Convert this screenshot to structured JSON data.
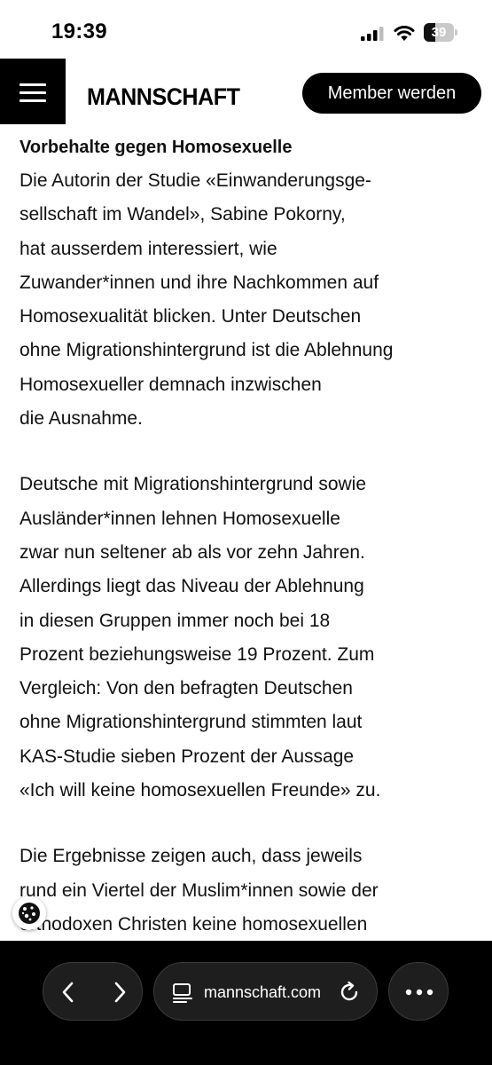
{
  "status_bar": {
    "time": "19:39",
    "battery_level": "39"
  },
  "header": {
    "logo": "MANNSCHAFT",
    "member_button": "Member werden"
  },
  "article": {
    "subheading": "Vorbehalte gegen Homosexuelle",
    "paragraphs": [
      [
        "Die Autorin der Studie «Einwanderungsge-",
        "sellschaft im Wandel», Sabine Pokorny,",
        "hat ausserdem interessiert, wie",
        "Zuwander*innen und ihre Nachkommen auf",
        "Homosexualität blicken. Unter Deutschen",
        "ohne Migrationshintergrund ist die Ablehnung",
        "Homosexueller demnach inzwischen",
        "die Ausnahme."
      ],
      [
        "Deutsche mit Migrationshintergrund sowie",
        "Ausländer*innen lehnen Homosexuelle",
        "zwar nun seltener ab als vor zehn Jahren.",
        "Allerdings liegt das Niveau der Ablehnung",
        "in diesen Gruppen immer noch bei 18",
        "Prozent beziehungsweise 19 Prozent. Zum",
        "Vergleich: Von den befragten Deutschen",
        "ohne Migrationshintergrund stimmten laut",
        "KAS-Studie sieben Prozent der Aussage",
        "«Ich will keine homosexuellen Freunde» zu."
      ],
      [
        "Die Ergebnisse zeigen auch, dass jeweils",
        "rund ein Viertel der Muslim*innen sowie der",
        "orthodoxen Christen keine homosexuellen"
      ]
    ]
  },
  "browser": {
    "url": "mannschaft.com"
  },
  "colors": {
    "header_black": "#000000",
    "toolbar_pill": "#1e1e1e",
    "text": "#111111"
  },
  "icons": [
    "menu-icon",
    "signal-icon",
    "wifi-icon",
    "battery-icon",
    "cookie-icon",
    "back-arrow-icon",
    "forward-arrow-icon",
    "reader-mode-icon",
    "reload-icon",
    "more-icon"
  ]
}
